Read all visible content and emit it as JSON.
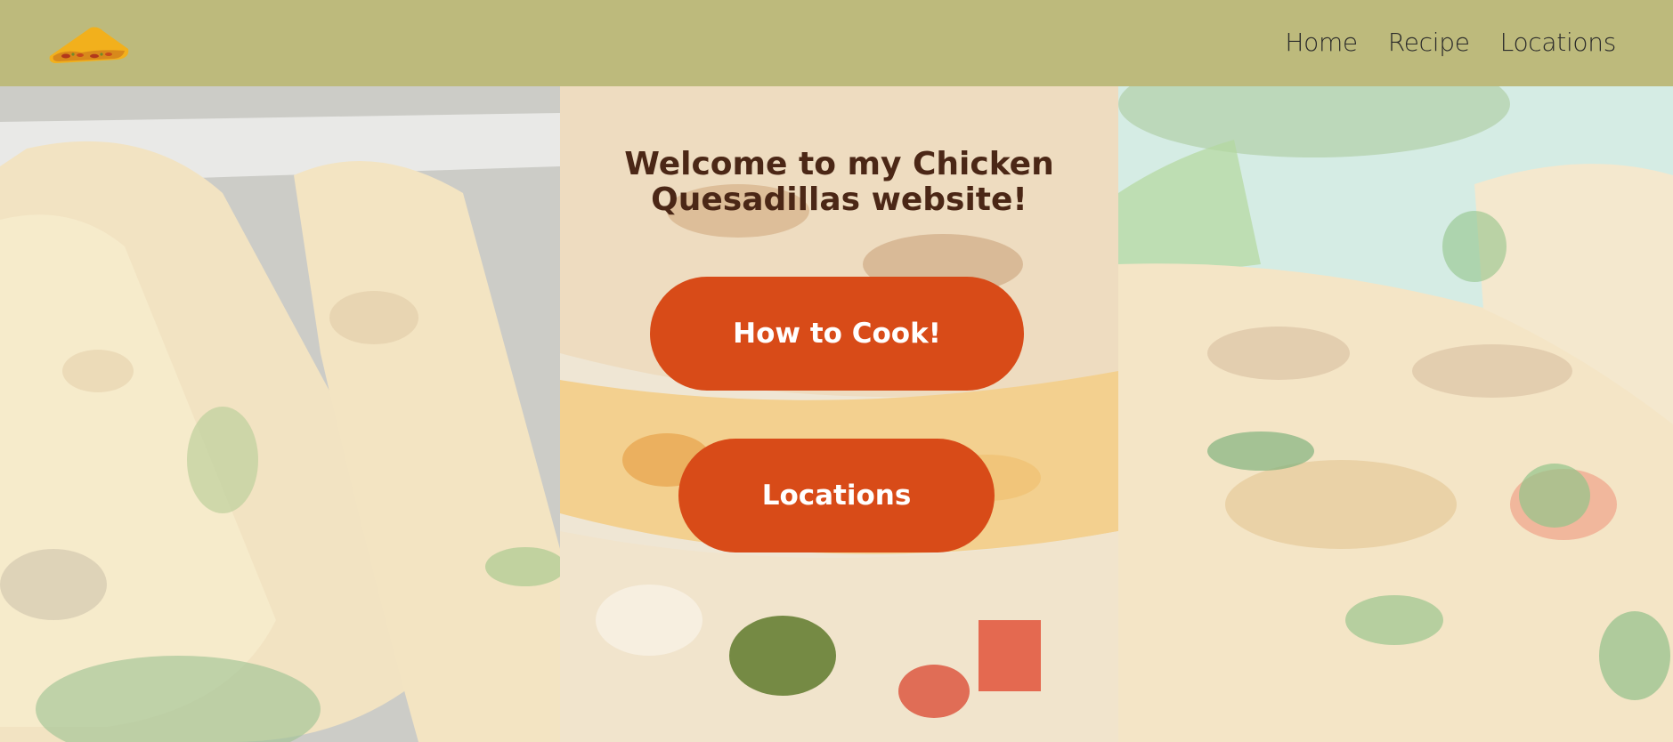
{
  "header": {
    "logo_icon": "quesadilla-logo-icon",
    "nav": [
      {
        "label": "Home"
      },
      {
        "label": "Recipe"
      },
      {
        "label": "Locations"
      }
    ]
  },
  "hero": {
    "title": "Welcome to my Chicken Quesadillas website!",
    "buttons": {
      "cook_label": "How to Cook!",
      "locations_label": "Locations"
    }
  },
  "colors": {
    "header_bg": "#bdba7c",
    "button_bg": "#d84b18",
    "title_text": "#4b2716",
    "button_text": "#ffffff"
  }
}
